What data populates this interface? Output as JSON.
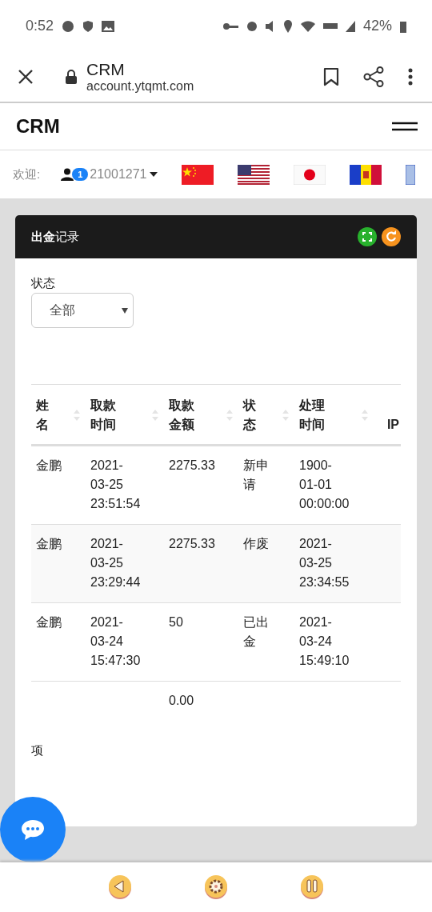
{
  "status_bar": {
    "time": "0:52",
    "battery": "42%"
  },
  "browser": {
    "title": "CRM",
    "url": "account.ytqmt.com"
  },
  "site": {
    "logo": "CRM"
  },
  "user_bar": {
    "welcome": "欢迎:",
    "badge": "1",
    "account": "21001271"
  },
  "panel": {
    "title": "**出金**记录",
    "filter": {
      "label": "状态",
      "value": "全部"
    },
    "table": {
      "columns": [
        {
          "label": "姓名",
          "sortable": true
        },
        {
          "label": "取款时间",
          "sortable": true
        },
        {
          "label": "取款金额",
          "sortable": true
        },
        {
          "label": "状态",
          "sortable": true
        },
        {
          "label": "处理时间",
          "sortable": true
        },
        {
          "label": "IP",
          "sortable": false
        }
      ],
      "rows": [
        [
          "金鹏",
          "2021-03-25 23:51:54",
          "2275.33",
          "新申请",
          "1900-01-01 00:00:00"
        ],
        [
          "金鹏",
          "2021-03-25 23:29:44",
          "2275.33",
          "作废",
          "2021-03-25 23:34:55"
        ],
        [
          "金鹏",
          "2021-03-24 15:47:30",
          "50",
          "已出金",
          "2021-03-24 15:49:10"
        ]
      ],
      "total": "0.00"
    },
    "footer_text": "项"
  }
}
